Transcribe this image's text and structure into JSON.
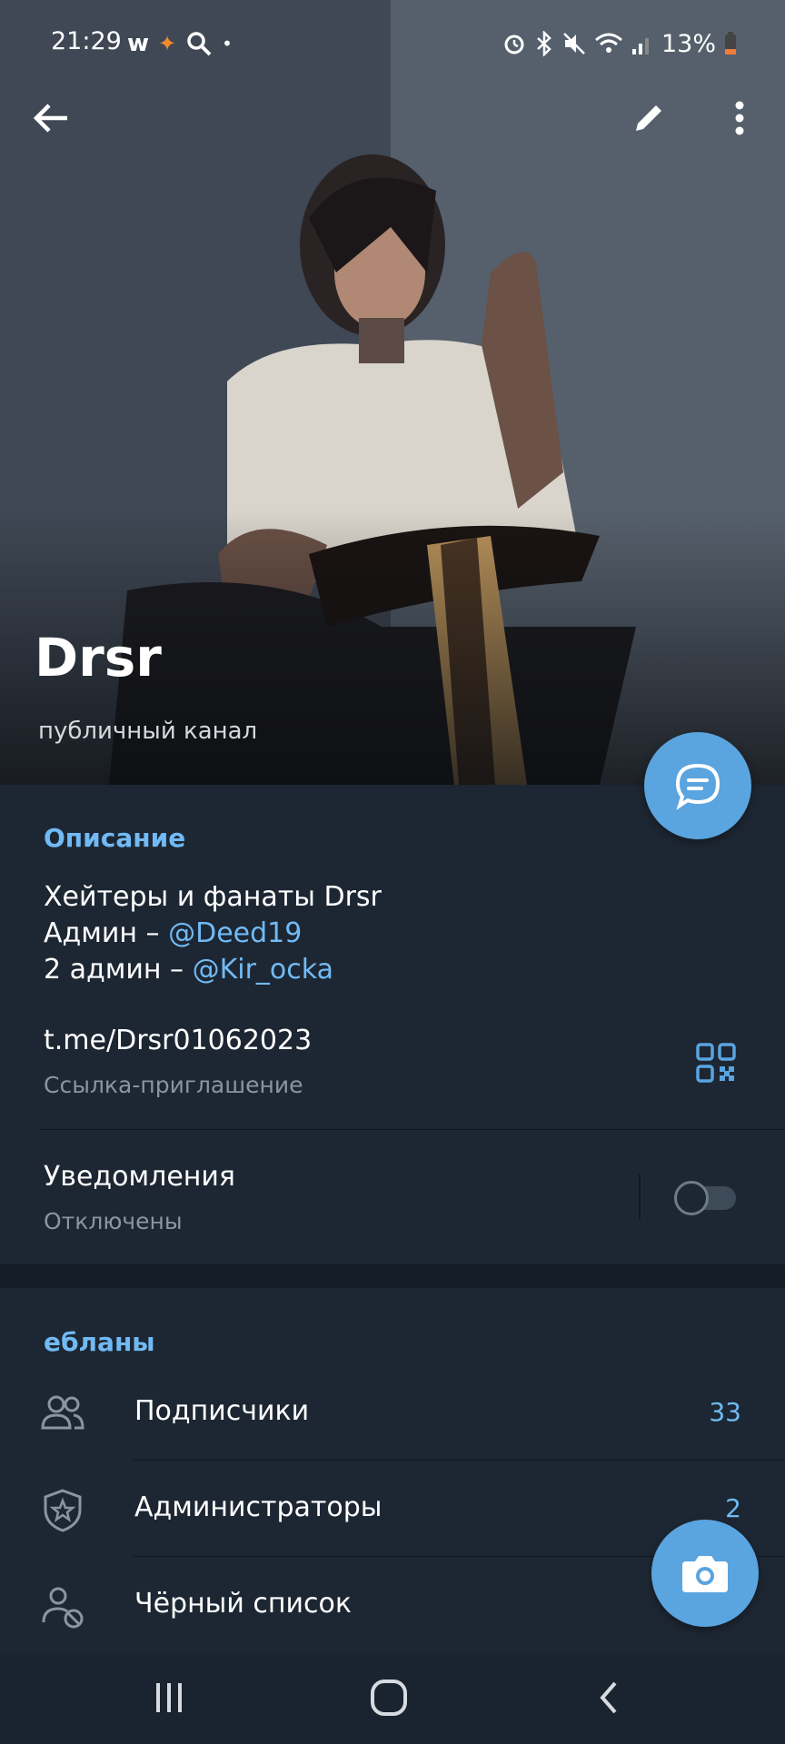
{
  "status_bar": {
    "time": "21:29",
    "battery": "13%",
    "left_icons": [
      "w-icon",
      "messenger-icon",
      "search-icon",
      "dot-icon"
    ],
    "right_icons": [
      "alarm-icon",
      "bluetooth-icon",
      "mute-icon",
      "wifi-icon",
      "signal-icon",
      "battery-icon"
    ]
  },
  "toolbar": {
    "back_icon": "arrow-left-icon",
    "edit_icon": "pencil-icon",
    "menu_icon": "more-vertical-icon"
  },
  "channel": {
    "name": "Drsr",
    "subtitle": "публичный канал"
  },
  "info": {
    "description_title": "Описание",
    "description_lines": [
      {
        "text": "Хейтеры и фанаты Drsr",
        "mention": ""
      },
      {
        "text": "Админ – ",
        "mention": "@Deed19"
      },
      {
        "text": "2 админ – ",
        "mention": "@Kir_ocka"
      }
    ],
    "link": "t.me/Drsr01062023",
    "link_caption": "Ссылка-приглашение",
    "notifications_title": "Уведомления",
    "notifications_status": "Отключены",
    "notifications_enabled": false
  },
  "members_section": {
    "title": "ебланы",
    "items": [
      {
        "label": "Подписчики",
        "count": "33",
        "icon": "users-icon"
      },
      {
        "label": "Администраторы",
        "count": "2",
        "icon": "shield-star-icon"
      },
      {
        "label": "Чёрный список",
        "count": "",
        "icon": "user-blocked-icon"
      }
    ]
  },
  "colors": {
    "accent": "#5aa4df",
    "link": "#71baf4",
    "background": "#1d2733"
  }
}
